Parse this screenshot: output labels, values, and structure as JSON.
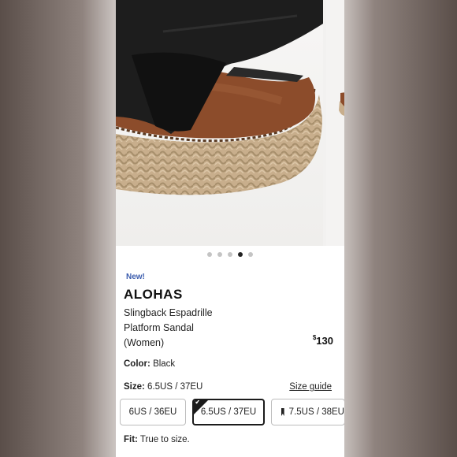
{
  "product": {
    "badge": "New!",
    "brand": "ALOHAS",
    "name_lines": [
      "Slingback Espadrille",
      "Platform Sandal",
      "(Women)"
    ],
    "price": "130",
    "currency": "$"
  },
  "carousel": {
    "dot_count": 5,
    "active_index": 3,
    "image_icon": "black-leather-espadrille-sandal"
  },
  "color": {
    "label": "Color:",
    "value": "Black"
  },
  "size": {
    "label": "Size:",
    "value": "6.5US / 37EU",
    "guide_label": "Size guide",
    "options": [
      {
        "label": "6US / 36EU",
        "selected": false,
        "icon": ""
      },
      {
        "label": "6.5US / 37EU",
        "selected": true,
        "icon": "check-icon"
      },
      {
        "label": "7.5US / 38EU",
        "selected": false,
        "icon": "bookmark-icon"
      }
    ]
  },
  "fit": {
    "label": "Fit:",
    "value": "True to size."
  },
  "colors": {
    "accent_blue": "#3b5cad",
    "leather": "#1c1c1c",
    "insole": "#8a4a2a",
    "jute": "#c9b090"
  }
}
